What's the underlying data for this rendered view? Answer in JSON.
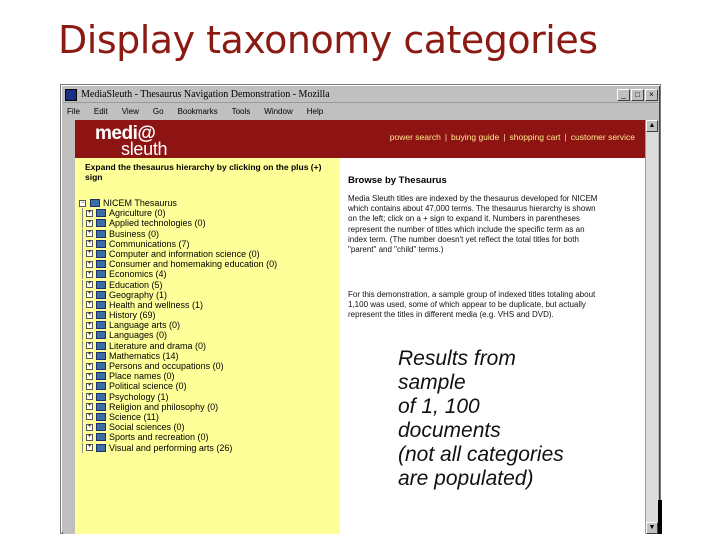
{
  "slide": {
    "title": "Display taxonomy categories",
    "annotation": [
      "Results from",
      "sample",
      "of 1, 100",
      "documents",
      "(not all categories",
      "are populated)"
    ]
  },
  "window": {
    "title": "MediaSleuth - Thesaurus Navigation Demonstration - Mozilla",
    "controls": [
      "_",
      "□",
      "×"
    ],
    "menu": [
      "File",
      "Edit",
      "View",
      "Go",
      "Bookmarks",
      "Tools",
      "Window",
      "Help"
    ]
  },
  "site": {
    "logo_top": "medi@",
    "logo_bottom": "sleuth",
    "nav": [
      "power search",
      "buying guide",
      "shopping cart",
      "customer service"
    ],
    "nav_separator": "|",
    "accent": "#8e1414",
    "panel_color": "#ffff99"
  },
  "tree": {
    "instructions": "Expand the thesaurus hierarchy by clicking on the plus (+) sign",
    "root": "NICEM Thesaurus",
    "items": [
      "Agriculture (0)",
      "Applied technologies (0)",
      "Business (0)",
      "Communications (7)",
      "Computer and information science (0)",
      "Consumer and homemaking education (0)",
      "Economics (4)",
      "Education (5)",
      "Geography (1)",
      "Health and wellness (1)",
      "History (69)",
      "Language arts (0)",
      "Languages (0)",
      "Literature and drama (0)",
      "Mathematics (14)",
      "Persons and occupations (0)",
      "Place names (0)",
      "Political science (0)",
      "Psychology (1)",
      "Religion and philosophy (0)",
      "Science (11)",
      "Social sciences (0)",
      "Sports and recreation (0)",
      "Visual and performing arts (26)"
    ]
  },
  "browse": {
    "title": "Browse by Thesaurus",
    "paragraph1": "Media Sleuth titles are indexed by the thesaurus developed for NICEM which contains about 47,000 terms. The thesaurus hierarchy is shown on the left; click on a + sign to expand it. Numbers in parentheses represent the number of titles which include the specific term as an index term. (The number doesn't yet reflect the total titles for both \"parent\" and \"child\" terms.)",
    "paragraph2": "For this demonstration, a sample group of indexed titles totaling about 1,100 was used, some of which appear to be duplicate, but actually represent the titles in different media (e.g. VHS and DVD)."
  }
}
